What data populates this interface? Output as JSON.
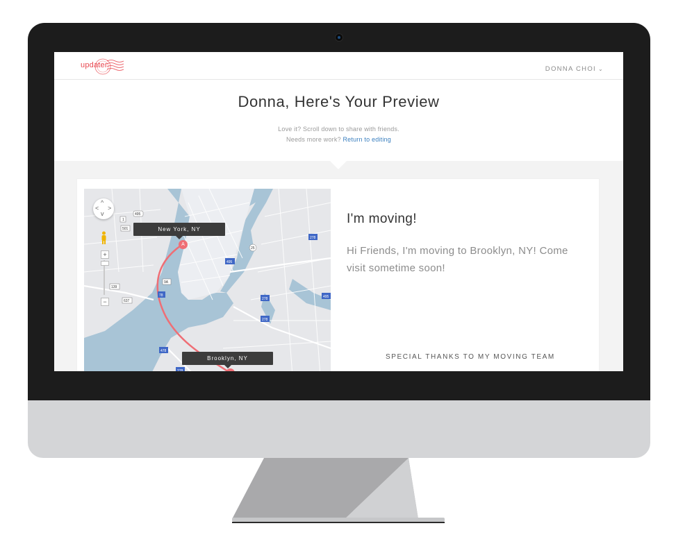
{
  "app": {
    "logo_text": "updater",
    "user_name": "DONNA CHOI",
    "brand_color": "#e8474f",
    "link_color": "#3a7fbf"
  },
  "hero": {
    "title": "Donna, Here's Your Preview",
    "line1": "Love it? Scroll down to share with friends.",
    "line2_prefix": "Needs more work?",
    "line2_link": "Return to editing"
  },
  "map": {
    "origin_label": "New York, NY",
    "destination_label": "Brooklyn, NY",
    "origin_marker": "A",
    "route_color": "#ef6e75",
    "road_shields": [
      "495",
      "1",
      "501",
      "25",
      "278",
      "495",
      "9A",
      "139",
      "637",
      "78",
      "278",
      "495",
      "278",
      "478",
      "278"
    ],
    "zoom_in": "+",
    "zoom_out": "−"
  },
  "message": {
    "title": "I'm moving!",
    "body": "Hi Friends, I'm moving to Brooklyn, NY! Come visit sometime soon!"
  },
  "team": {
    "title": "SPECIAL THANKS TO MY MOVING TEAM"
  }
}
